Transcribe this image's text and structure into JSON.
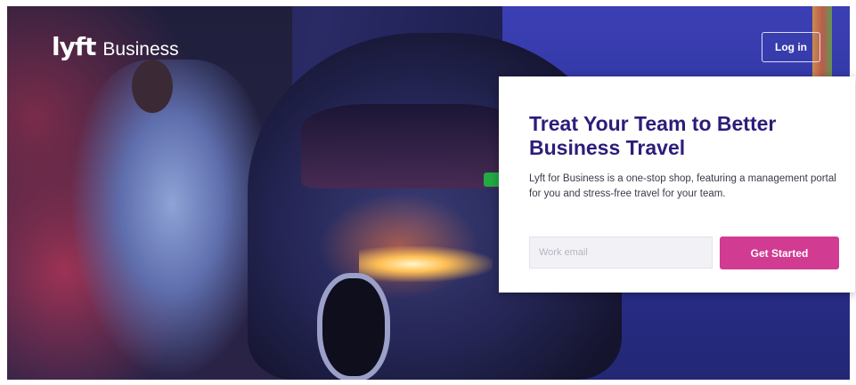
{
  "header": {
    "logo_mark": "lyft",
    "logo_text": "Business",
    "login_label": "Log in"
  },
  "hero": {
    "title": "Treat Your Team to Better Business Travel",
    "description": "Lyft for Business is a one-stop shop, featuring a management portal for you and stress-free travel for your team.",
    "email_placeholder": "Work email",
    "cta_label": "Get Started"
  },
  "colors": {
    "title": "#2b1e7a",
    "cta": "#d13b91",
    "card_bg": "#ffffff"
  }
}
